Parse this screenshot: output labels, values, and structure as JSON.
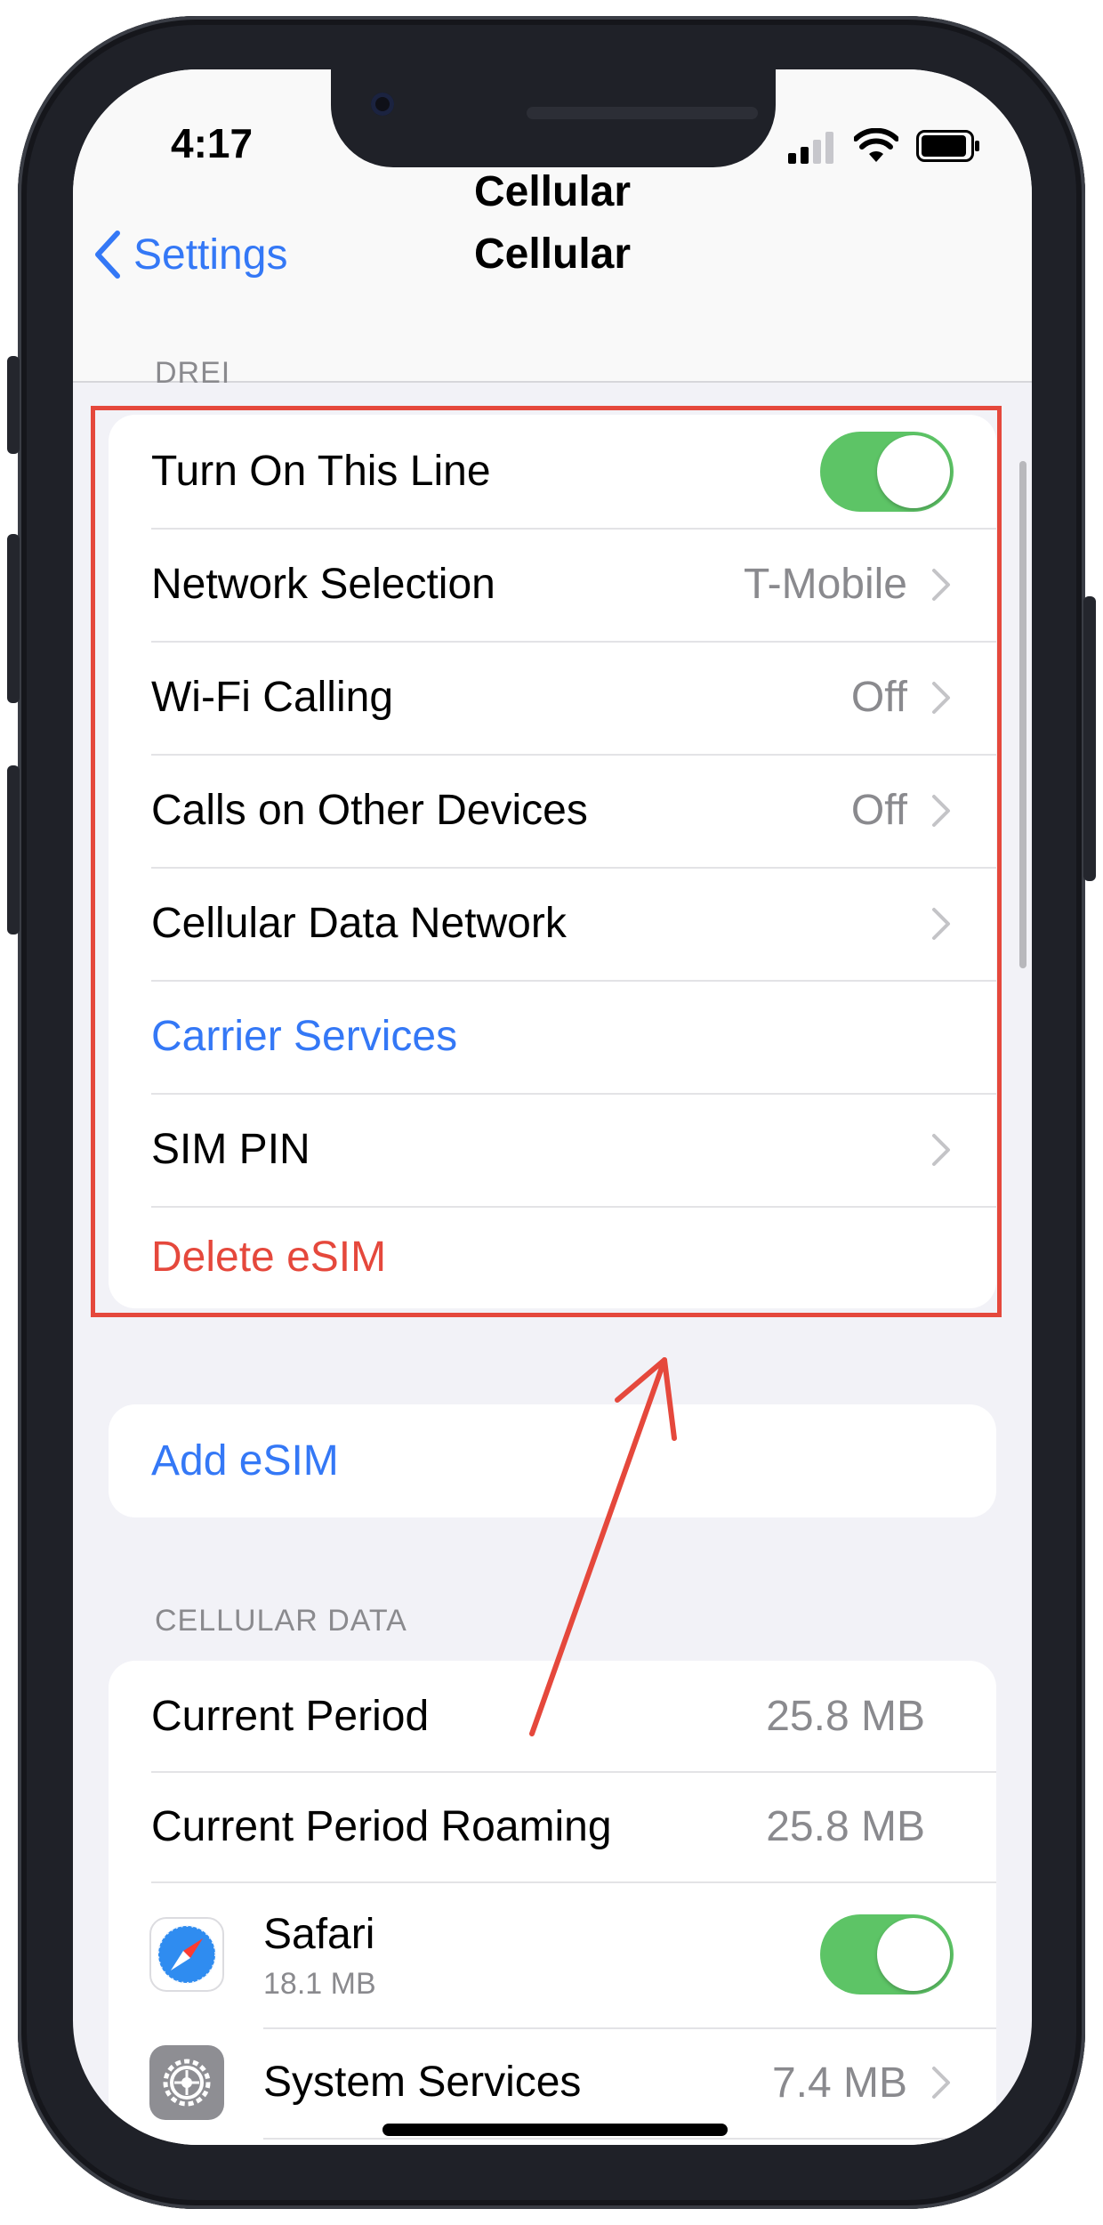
{
  "status_bar": {
    "time": "4:17"
  },
  "nav": {
    "back_label": "Settings",
    "title": "Cellular"
  },
  "line_section": {
    "header": "DREI",
    "rows": [
      {
        "label": "Turn On This Line",
        "toggle_on": true
      },
      {
        "label": "Network Selection",
        "value": "T-Mobile"
      },
      {
        "label": "Wi-Fi Calling",
        "value": "Off"
      },
      {
        "label": "Calls on Other Devices",
        "value": "Off"
      },
      {
        "label": "Cellular Data Network"
      },
      {
        "label": "Carrier Services"
      },
      {
        "label": "SIM PIN"
      },
      {
        "label": "Delete eSIM"
      }
    ]
  },
  "add_esim": {
    "label": "Add eSIM"
  },
  "cellular_data": {
    "header": "CELLULAR DATA",
    "rows": [
      {
        "label": "Current Period",
        "value": "25.8 MB"
      },
      {
        "label": "Current Period Roaming",
        "value": "25.8 MB"
      },
      {
        "label": "Safari",
        "sublabel": "18.1 MB",
        "toggle_on": true,
        "icon": "safari-icon"
      },
      {
        "label": "System Services",
        "value": "7.4 MB",
        "icon": "gear-icon"
      }
    ]
  },
  "colors": {
    "accent": "#3478f6",
    "destructive": "#e5483c",
    "toggle_on": "#5dc466",
    "annotation": "#e5483c"
  }
}
